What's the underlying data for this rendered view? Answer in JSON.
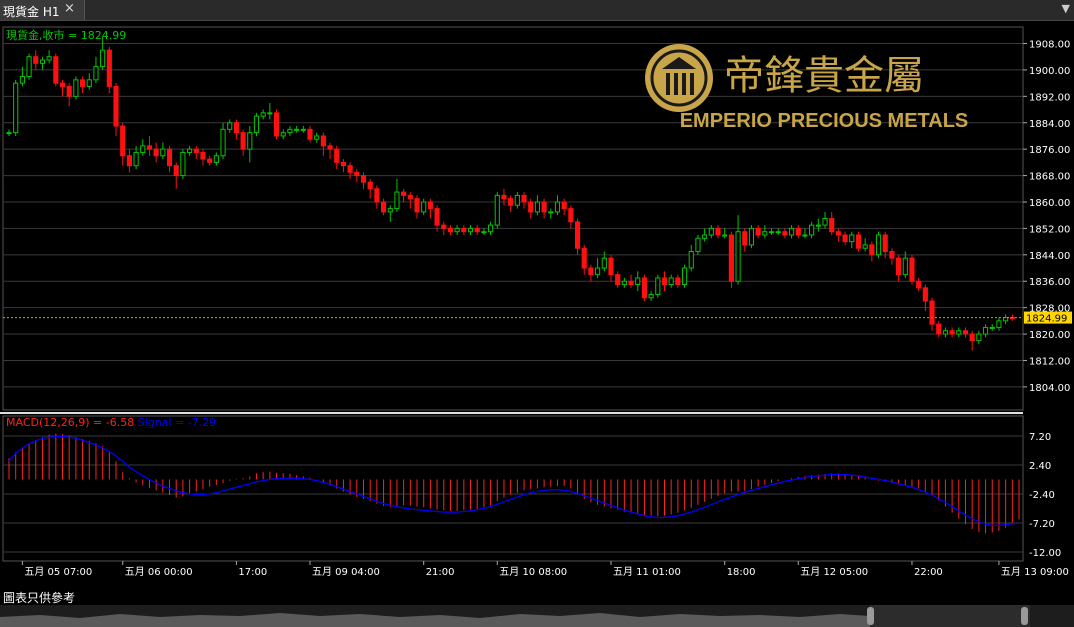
{
  "window": {
    "tab_label": "現貨金 H1",
    "close_icon": "×",
    "menu_icon": "▼"
  },
  "footer_note": "圖表只供參考",
  "brand": {
    "chinese": "帝鋒貴金屬",
    "english": "EMPERIO PRECIOUS METALS",
    "gold": "#c9a54a"
  },
  "chart_data": [
    {
      "type": "candlestick",
      "title": "現貨金,收市 = 1824.99",
      "last_price": 1824.99,
      "last_price_label": "1824.99",
      "y_ticks": [
        1804,
        1812,
        1820,
        1828,
        1836,
        1844,
        1852,
        1860,
        1868,
        1876,
        1884,
        1892,
        1900,
        1908
      ],
      "y_tick_labels": [
        "1804.00",
        "1812.00",
        "1820.00",
        "1828.00",
        "1836.00",
        "1844.00",
        "1852.00",
        "1860.00",
        "1868.00",
        "1876.00",
        "1884.00",
        "1892.00",
        "1900.00",
        "1908.00"
      ],
      "ylim": [
        1797,
        1913
      ],
      "x_labels": [
        {
          "label": "五月 05 07:00",
          "index": 2
        },
        {
          "label": "五月 06 00:00",
          "index": 17
        },
        {
          "label": "17:00",
          "index": 34
        },
        {
          "label": "五月 09 04:00",
          "index": 45
        },
        {
          "label": "21:00",
          "index": 62
        },
        {
          "label": "五月 10 08:00",
          "index": 73
        },
        {
          "label": "五月 11 01:00",
          "index": 90
        },
        {
          "label": "18:00",
          "index": 107
        },
        {
          "label": "五月 12 05:00",
          "index": 118
        },
        {
          "label": "22:00",
          "index": 135
        },
        {
          "label": "五月 13 09:00",
          "index": 148
        }
      ],
      "colors": {
        "up": "#00c800",
        "down": "#ff1010",
        "grid": "#3a3a3a",
        "text": "#ffffff",
        "last": "#ffd700",
        "last_line": "#d4a017"
      },
      "candles": [
        [
          1881,
          1881,
          1880,
          1882
        ],
        [
          1881,
          1896,
          1880,
          1897
        ],
        [
          1896,
          1898,
          1895,
          1901
        ],
        [
          1898,
          1904,
          1897,
          1905
        ],
        [
          1904,
          1902,
          1900,
          1906
        ],
        [
          1902,
          1903,
          1900,
          1904
        ],
        [
          1903,
          1904,
          1902,
          1906
        ],
        [
          1904,
          1896,
          1895,
          1905
        ],
        [
          1896,
          1895,
          1892,
          1897
        ],
        [
          1895,
          1892,
          1889,
          1896
        ],
        [
          1892,
          1897,
          1891,
          1898
        ],
        [
          1897,
          1895,
          1893,
          1898
        ],
        [
          1895,
          1897,
          1894,
          1899
        ],
        [
          1897,
          1901,
          1896,
          1904
        ],
        [
          1901,
          1906,
          1900,
          1910
        ],
        [
          1906,
          1895,
          1893,
          1907
        ],
        [
          1895,
          1883,
          1880,
          1896
        ],
        [
          1883,
          1874,
          1871,
          1884
        ],
        [
          1874,
          1871,
          1869,
          1876
        ],
        [
          1871,
          1875,
          1870,
          1877
        ],
        [
          1875,
          1877,
          1874,
          1879
        ],
        [
          1877,
          1876,
          1874,
          1880
        ],
        [
          1876,
          1874,
          1872,
          1878
        ],
        [
          1874,
          1876,
          1873,
          1878
        ],
        [
          1876,
          1871,
          1869,
          1877
        ],
        [
          1871,
          1868,
          1864,
          1872
        ],
        [
          1868,
          1875,
          1867,
          1876
        ],
        [
          1875,
          1876,
          1874,
          1877
        ],
        [
          1876,
          1875,
          1873,
          1877
        ],
        [
          1875,
          1873,
          1871,
          1876
        ],
        [
          1873,
          1872,
          1871,
          1874
        ],
        [
          1872,
          1874,
          1871,
          1875
        ],
        [
          1874,
          1882,
          1873,
          1884
        ],
        [
          1882,
          1884,
          1881,
          1885
        ],
        [
          1884,
          1881,
          1879,
          1885
        ],
        [
          1881,
          1876,
          1874,
          1882
        ],
        [
          1876,
          1881,
          1872,
          1883
        ],
        [
          1881,
          1886,
          1880,
          1887
        ],
        [
          1886,
          1887,
          1885,
          1888
        ],
        [
          1887,
          1887,
          1885,
          1890
        ],
        [
          1887,
          1880,
          1879,
          1888
        ],
        [
          1880,
          1881,
          1879,
          1882
        ],
        [
          1881,
          1882,
          1880,
          1883
        ],
        [
          1882,
          1882,
          1881,
          1883
        ],
        [
          1882,
          1882,
          1881,
          1883
        ],
        [
          1882,
          1879,
          1878,
          1883
        ],
        [
          1879,
          1880,
          1878,
          1881
        ],
        [
          1880,
          1877,
          1874,
          1881
        ],
        [
          1877,
          1876,
          1873,
          1878
        ],
        [
          1876,
          1872,
          1870,
          1877
        ],
        [
          1872,
          1871,
          1869,
          1873
        ],
        [
          1871,
          1869,
          1867,
          1872
        ],
        [
          1869,
          1868,
          1866,
          1870
        ],
        [
          1868,
          1866,
          1864,
          1869
        ],
        [
          1866,
          1864,
          1861,
          1867
        ],
        [
          1864,
          1860,
          1858,
          1865
        ],
        [
          1860,
          1857,
          1856,
          1861
        ],
        [
          1857,
          1858,
          1854,
          1859
        ],
        [
          1858,
          1863,
          1857,
          1867
        ],
        [
          1863,
          1862,
          1860,
          1864
        ],
        [
          1862,
          1861,
          1858,
          1863
        ],
        [
          1861,
          1857,
          1855,
          1862
        ],
        [
          1857,
          1860,
          1856,
          1861
        ],
        [
          1860,
          1858,
          1855,
          1861
        ],
        [
          1858,
          1853,
          1851,
          1859
        ],
        [
          1853,
          1852,
          1850,
          1854
        ],
        [
          1852,
          1851,
          1850,
          1853
        ],
        [
          1851,
          1852,
          1850,
          1853
        ],
        [
          1852,
          1851,
          1850,
          1853
        ],
        [
          1851,
          1852,
          1850,
          1853
        ],
        [
          1852,
          1851,
          1850,
          1853
        ],
        [
          1851,
          1851,
          1850,
          1852
        ],
        [
          1851,
          1853,
          1850,
          1854
        ],
        [
          1853,
          1862,
          1852,
          1863
        ],
        [
          1862,
          1861,
          1859,
          1864
        ],
        [
          1861,
          1859,
          1857,
          1862
        ],
        [
          1859,
          1862,
          1858,
          1863
        ],
        [
          1862,
          1860,
          1858,
          1863
        ],
        [
          1860,
          1857,
          1855,
          1861
        ],
        [
          1857,
          1860,
          1856,
          1862
        ],
        [
          1860,
          1857,
          1855,
          1861
        ],
        [
          1857,
          1857,
          1855,
          1858
        ],
        [
          1857,
          1860,
          1856,
          1862
        ],
        [
          1860,
          1858,
          1856,
          1861
        ],
        [
          1858,
          1854,
          1852,
          1859
        ],
        [
          1854,
          1846,
          1844,
          1855
        ],
        [
          1846,
          1840,
          1838,
          1847
        ],
        [
          1840,
          1838,
          1836,
          1841
        ],
        [
          1838,
          1840,
          1837,
          1843
        ],
        [
          1840,
          1843,
          1839,
          1845
        ],
        [
          1843,
          1838,
          1836,
          1844
        ],
        [
          1838,
          1835,
          1834,
          1839
        ],
        [
          1835,
          1836,
          1834,
          1837
        ],
        [
          1836,
          1835,
          1834,
          1838
        ],
        [
          1835,
          1837,
          1833,
          1839
        ],
        [
          1837,
          1831,
          1830,
          1838
        ],
        [
          1831,
          1832,
          1830,
          1833
        ],
        [
          1832,
          1837,
          1831,
          1838
        ],
        [
          1837,
          1835,
          1833,
          1839
        ],
        [
          1835,
          1837,
          1834,
          1838
        ],
        [
          1837,
          1835,
          1834,
          1838
        ],
        [
          1835,
          1840,
          1834,
          1841
        ],
        [
          1840,
          1845,
          1839,
          1847
        ],
        [
          1845,
          1849,
          1844,
          1850
        ],
        [
          1849,
          1850,
          1848,
          1852
        ],
        [
          1850,
          1852,
          1849,
          1853
        ],
        [
          1852,
          1850,
          1849,
          1853
        ],
        [
          1850,
          1850,
          1849,
          1852
        ],
        [
          1850,
          1836,
          1834,
          1851
        ],
        [
          1836,
          1851,
          1835,
          1856
        ],
        [
          1851,
          1847,
          1845,
          1852
        ],
        [
          1847,
          1852,
          1846,
          1853
        ],
        [
          1852,
          1850,
          1849,
          1853
        ],
        [
          1850,
          1851,
          1849,
          1853
        ],
        [
          1851,
          1851,
          1850,
          1852
        ],
        [
          1851,
          1851,
          1850,
          1852
        ],
        [
          1851,
          1850,
          1849,
          1852
        ],
        [
          1850,
          1852,
          1849,
          1853
        ],
        [
          1852,
          1850,
          1849,
          1853
        ],
        [
          1850,
          1850,
          1849,
          1852
        ],
        [
          1850,
          1853,
          1849,
          1854
        ],
        [
          1853,
          1853,
          1851,
          1855
        ],
        [
          1853,
          1855,
          1852,
          1857
        ],
        [
          1855,
          1851,
          1850,
          1857
        ],
        [
          1851,
          1850,
          1848,
          1852
        ],
        [
          1850,
          1848,
          1847,
          1851
        ],
        [
          1848,
          1850,
          1846,
          1851
        ],
        [
          1850,
          1846,
          1845,
          1851
        ],
        [
          1846,
          1847,
          1845,
          1849
        ],
        [
          1847,
          1844,
          1842,
          1848
        ],
        [
          1844,
          1850,
          1843,
          1851
        ],
        [
          1850,
          1845,
          1843,
          1851
        ],
        [
          1845,
          1843,
          1841,
          1846
        ],
        [
          1843,
          1838,
          1836,
          1844
        ],
        [
          1838,
          1843,
          1837,
          1845
        ],
        [
          1843,
          1836,
          1835,
          1844
        ],
        [
          1836,
          1834,
          1833,
          1837
        ],
        [
          1834,
          1830,
          1827,
          1835
        ],
        [
          1830,
          1823,
          1821,
          1831
        ],
        [
          1823,
          1820,
          1819,
          1824
        ],
        [
          1820,
          1821,
          1819,
          1822
        ],
        [
          1821,
          1820,
          1819,
          1822
        ],
        [
          1820,
          1821,
          1819,
          1822
        ],
        [
          1821,
          1820,
          1819,
          1822
        ],
        [
          1820,
          1818,
          1815,
          1821
        ],
        [
          1818,
          1820,
          1817,
          1821
        ],
        [
          1820,
          1822,
          1819,
          1823
        ],
        [
          1822,
          1822,
          1821,
          1823
        ],
        [
          1822,
          1824,
          1821,
          1825
        ],
        [
          1824,
          1825,
          1823,
          1826
        ],
        [
          1825,
          1824.99,
          1824,
          1826
        ]
      ]
    },
    {
      "type": "macd",
      "title": "MACD(12,26,9) = -6.58",
      "signal_label": "Signal = -7.29",
      "y_tick_labels": [
        "7.20",
        "2.40",
        "-2.40",
        "-7.20",
        "-12.00"
      ],
      "y_ticks": [
        7.2,
        2.4,
        -2.4,
        -7.2,
        -12
      ],
      "ylim": [
        -13.5,
        10.5
      ],
      "colors": {
        "hist": "#ff2020",
        "signal": "#0000ff",
        "title": "#ff2020"
      },
      "hist": [
        3.5,
        4.5,
        5.3,
        6,
        6.5,
        7,
        7.4,
        7.6,
        7.5,
        7.3,
        7,
        6.7,
        6.4,
        6,
        5.5,
        4.5,
        3,
        1.2,
        0.2,
        -0.5,
        -1,
        -1.4,
        -1.8,
        -2.2,
        -2.6,
        -3,
        -2.8,
        -2.4,
        -2,
        -1.6,
        -1.2,
        -0.9,
        -0.6,
        -0.2,
        0.1,
        0.2,
        0.5,
        1,
        1.2,
        1.3,
        1.1,
        1,
        0.9,
        0.7,
        0.5,
        0.3,
        0,
        -0.5,
        -1,
        -1.5,
        -2,
        -2.5,
        -2.9,
        -3.2,
        -3.6,
        -4,
        -4.4,
        -4.6,
        -4.4,
        -4.3,
        -4.3,
        -4.5,
        -4.6,
        -4.8,
        -5,
        -5.1,
        -5.2,
        -5.2,
        -5.1,
        -5,
        -4.9,
        -4.6,
        -4.3,
        -3.6,
        -3,
        -2.5,
        -2.2,
        -1.8,
        -1.6,
        -1.5,
        -1.3,
        -1.2,
        -1.1,
        -1.1,
        -1.5,
        -2.5,
        -3.2,
        -3.8,
        -4.2,
        -4.5,
        -4.8,
        -5,
        -5.3,
        -5.5,
        -5.7,
        -5.9,
        -6,
        -6.1,
        -6,
        -5.8,
        -5.5,
        -5.1,
        -4.7,
        -4.2,
        -3.7,
        -3.2,
        -2.7,
        -2.3,
        -2,
        -2,
        -1.9,
        -1.6,
        -1.2,
        -0.9,
        -0.6,
        -0.3,
        0,
        0.2,
        0.4,
        0.6,
        0.7,
        0.8,
        0.9,
        1,
        1,
        0.9,
        0.7,
        0.5,
        0.3,
        0.1,
        -0.2,
        -0.4,
        -0.6,
        -0.8,
        -1,
        -1.2,
        -1.5,
        -2,
        -2.7,
        -3.5,
        -4.5,
        -5.5,
        -6.5,
        -7.4,
        -8.2,
        -8.7,
        -8.9,
        -8.8,
        -8.5,
        -8,
        -7.3,
        -6.6
      ],
      "signal": [
        3,
        4.3,
        5.2,
        5.9,
        6.4,
        6.8,
        7,
        7.1,
        7.1,
        7,
        6.8,
        6.5,
        6.1,
        5.7,
        5.2,
        4.6,
        3.9,
        3,
        2.1,
        1.3,
        0.6,
        0,
        -0.6,
        -1.1,
        -1.5,
        -1.9,
        -2.2,
        -2.4,
        -2.5,
        -2.5,
        -2.4,
        -2.2,
        -1.9,
        -1.6,
        -1.3,
        -1,
        -0.7,
        -0.4,
        -0.2,
        0,
        0.1,
        0.2,
        0.2,
        0.2,
        0.1,
        0,
        -0.2,
        -0.5,
        -0.8,
        -1.2,
        -1.6,
        -2,
        -2.4,
        -2.8,
        -3.2,
        -3.6,
        -4,
        -4.3,
        -4.5,
        -4.7,
        -4.9,
        -5,
        -5.1,
        -5.2,
        -5.3,
        -5.4,
        -5.4,
        -5.4,
        -5.3,
        -5.2,
        -5,
        -4.8,
        -4.5,
        -4.1,
        -3.7,
        -3.3,
        -2.9,
        -2.5,
        -2.2,
        -2,
        -1.8,
        -1.7,
        -1.7,
        -1.8,
        -2,
        -2.3,
        -2.7,
        -3.1,
        -3.5,
        -3.9,
        -4.3,
        -4.7,
        -5.1,
        -5.4,
        -5.7,
        -6,
        -6.2,
        -6.3,
        -6.3,
        -6.2,
        -6,
        -5.7,
        -5.4,
        -5,
        -4.6,
        -4.2,
        -3.7,
        -3.3,
        -2.9,
        -2.5,
        -2.1,
        -1.8,
        -1.5,
        -1.2,
        -0.9,
        -0.6,
        -0.3,
        -0.1,
        0.1,
        0.3,
        0.5,
        0.6,
        0.7,
        0.8,
        0.8,
        0.8,
        0.7,
        0.6,
        0.4,
        0.2,
        0,
        -0.2,
        -0.4,
        -0.7,
        -1,
        -1.3,
        -1.7,
        -2.1,
        -2.6,
        -3.2,
        -3.8,
        -4.5,
        -5.2,
        -5.9,
        -6.5,
        -7,
        -7.4,
        -7.6,
        -7.6,
        -7.5,
        -7.3,
        -7.3
      ]
    }
  ]
}
